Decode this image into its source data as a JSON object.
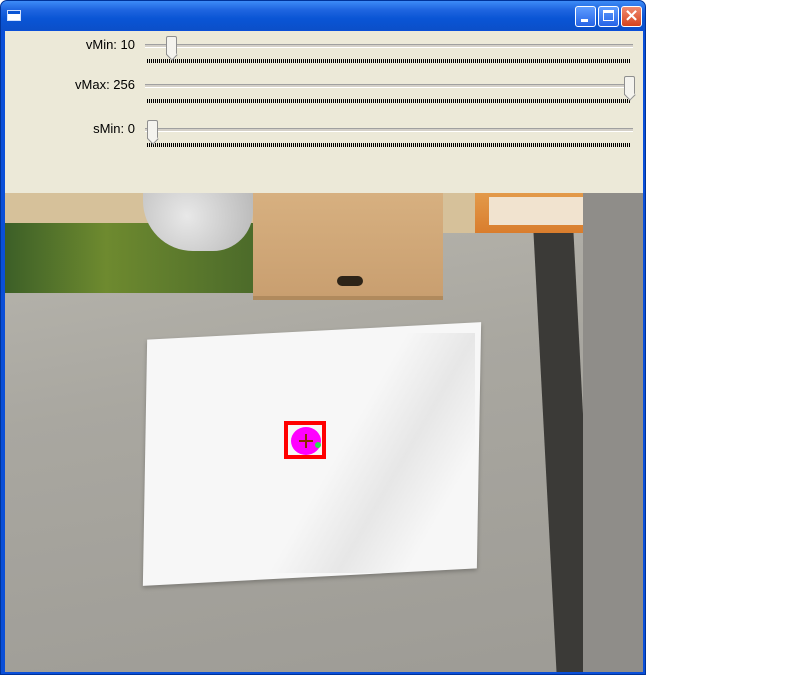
{
  "window": {
    "title": "",
    "buttons": {
      "minimize": "minimize-icon",
      "maximize": "maximize-icon",
      "close": "close-icon"
    }
  },
  "controls": [
    {
      "id": "vmin",
      "label": "vMin: 10",
      "value": 10,
      "max": 256
    },
    {
      "id": "vmax",
      "label": "vMax: 256",
      "value": 256,
      "max": 256
    },
    {
      "id": "smin",
      "label": "sMin: 0",
      "value": 0,
      "max": 256
    }
  ],
  "colors": {
    "title_bar": "#0a55d5",
    "tracking_box": "#ff0000",
    "tracked_blob": "#ff00ff",
    "marker": "#27e04e"
  }
}
